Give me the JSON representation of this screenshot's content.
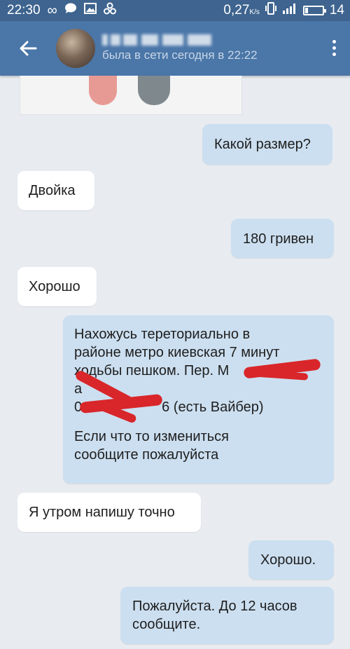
{
  "status_bar": {
    "time": "22:30",
    "speed_value": "0,27",
    "speed_unit": "K/s",
    "battery": "14"
  },
  "header": {
    "subtitle": "была в сети сегодня в 22:22"
  },
  "messages": [
    {
      "direction": "out",
      "text": "Какой размер?"
    },
    {
      "direction": "in",
      "text": "Двойка"
    },
    {
      "direction": "out",
      "text": "180 гривен"
    },
    {
      "direction": "in",
      "text": "Хорошо"
    },
    {
      "direction": "out",
      "lines": [
        "Нахожусь тереториально в",
        "районе метро киевская 7 минут",
        "ходьбы пешком. Пер. М",
        "а",
        "0",
        "6 (есть Вайбер)",
        "Если что то измениться",
        "сообщите пожалуйста"
      ]
    },
    {
      "direction": "in",
      "text": "Я утром напишу точно"
    },
    {
      "direction": "out",
      "text": "Хорошо."
    },
    {
      "direction": "out",
      "text": "Пожалуйста. До 12 часов\nсообщите."
    }
  ],
  "colors": {
    "status_bar": "#3e648f",
    "header": "#4a76a8",
    "background": "#e8ecf1",
    "incoming_bubble": "#ffffff",
    "outgoing_bubble": "#ccdff0",
    "redaction": "#d9262a"
  }
}
